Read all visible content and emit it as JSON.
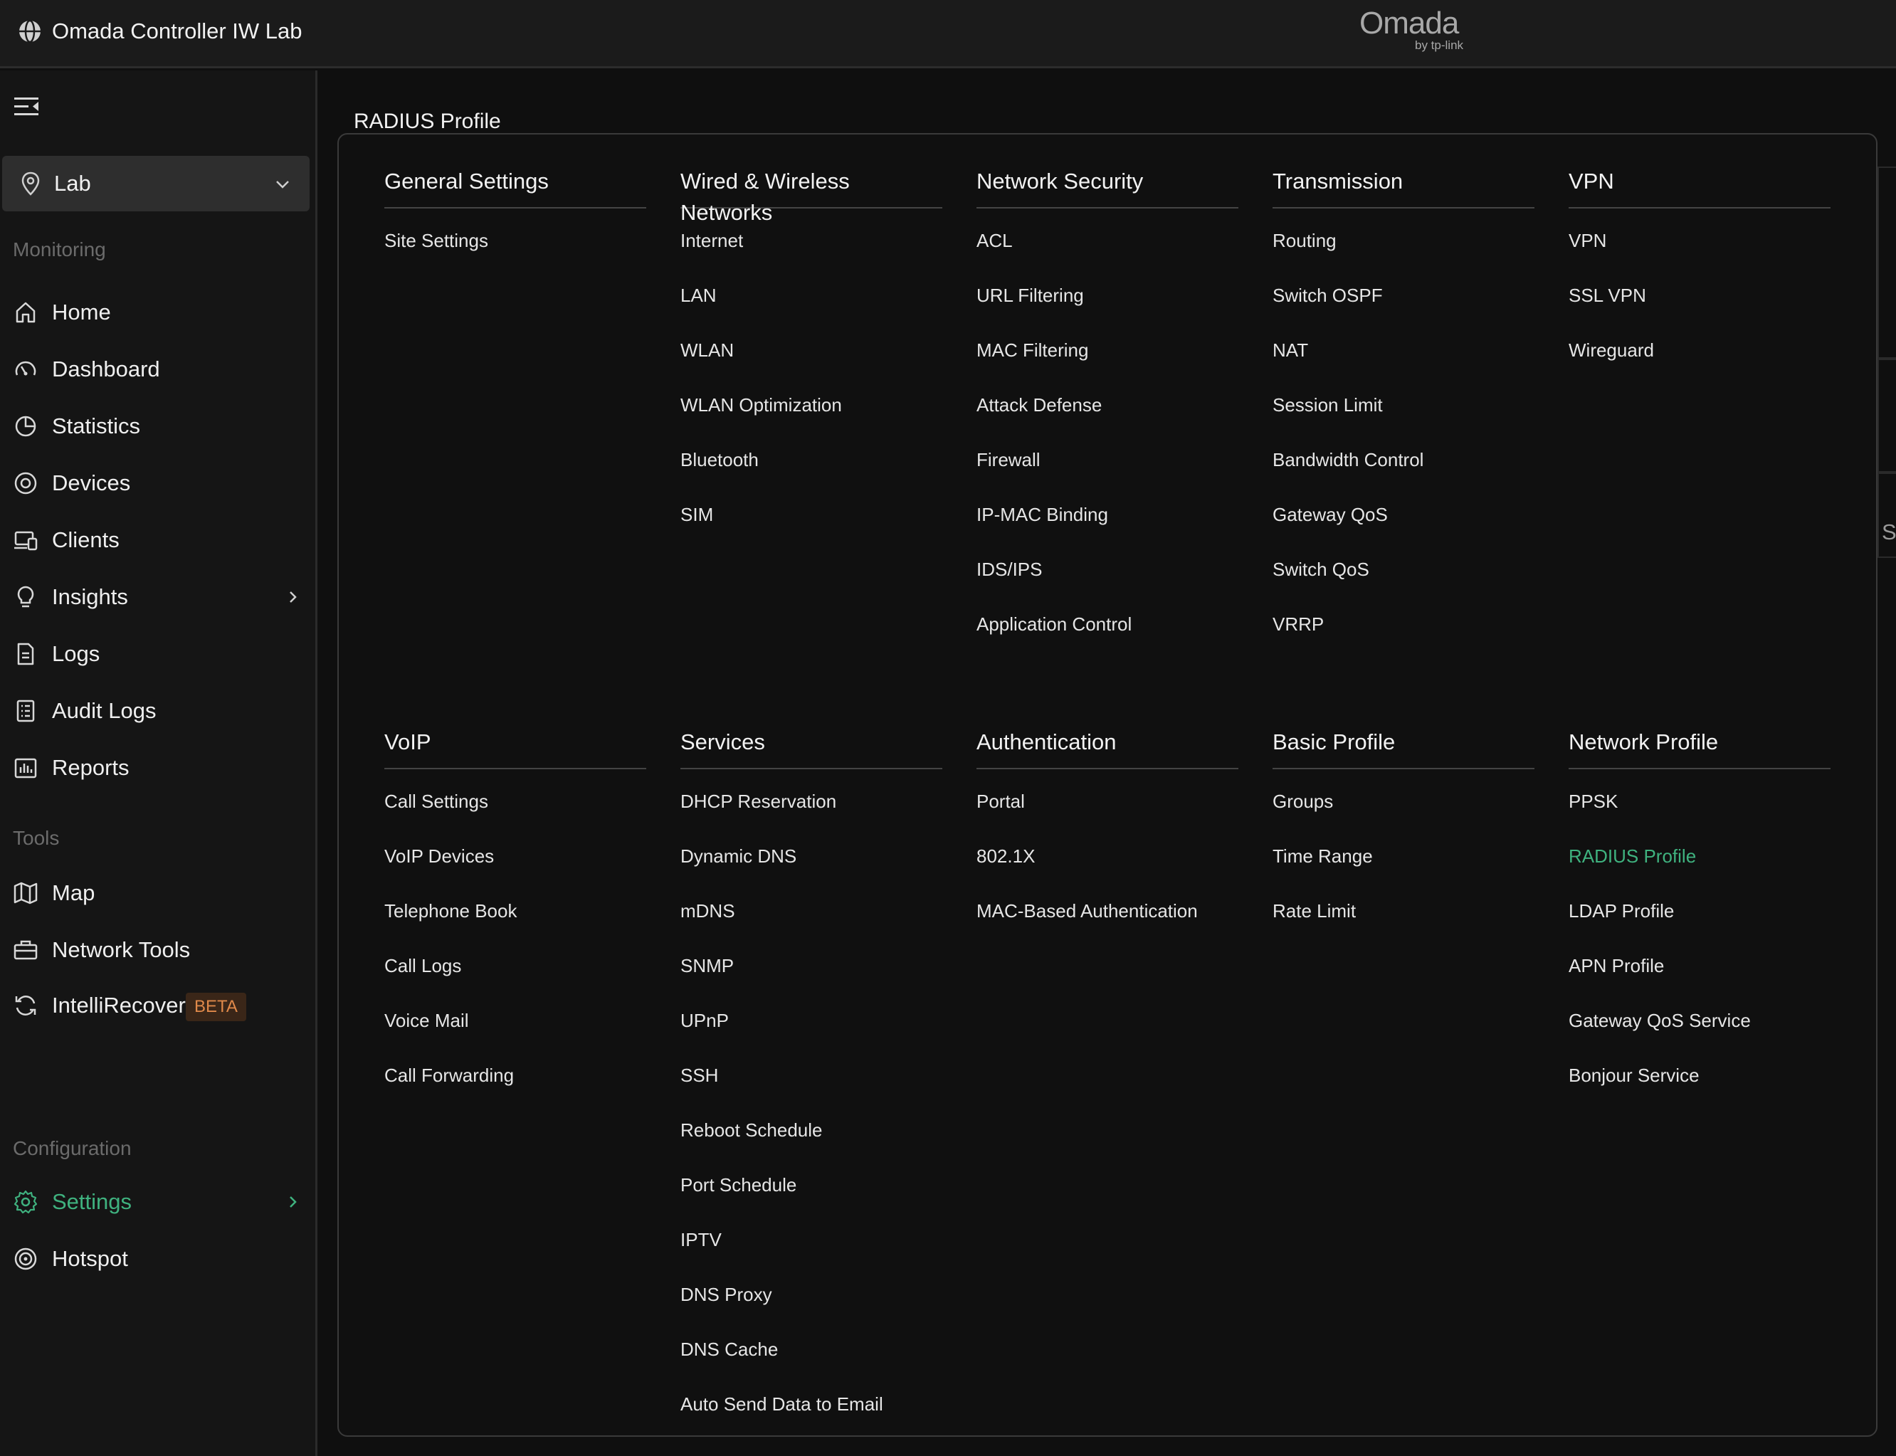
{
  "app": {
    "title": "Omada Controller IW Lab",
    "brand_name": "Omada",
    "brand_sub": "by tp-link"
  },
  "colors": {
    "accent": "#3fb27f",
    "background": "#0f0f0f",
    "beta_text": "#e0894a"
  },
  "sidebar": {
    "site_selector": {
      "value": "Lab"
    },
    "sections": [
      {
        "title": "Monitoring",
        "items": [
          {
            "label": "Home",
            "icon": "home-icon"
          },
          {
            "label": "Dashboard",
            "icon": "gauge-icon"
          },
          {
            "label": "Statistics",
            "icon": "pie-chart-icon"
          },
          {
            "label": "Devices",
            "icon": "devices-icon"
          },
          {
            "label": "Clients",
            "icon": "clients-icon"
          },
          {
            "label": "Insights",
            "icon": "lightbulb-icon",
            "has_arrow": true
          },
          {
            "label": "Logs",
            "icon": "document-icon"
          },
          {
            "label": "Audit Logs",
            "icon": "list-document-icon"
          },
          {
            "label": "Reports",
            "icon": "bar-chart-icon"
          }
        ]
      },
      {
        "title": "Tools",
        "items": [
          {
            "label": "Map",
            "icon": "map-icon"
          },
          {
            "label": "Network Tools",
            "icon": "toolbox-icon"
          },
          {
            "label": "IntelliRecover",
            "icon": "refresh-icon",
            "badge": "BETA"
          }
        ]
      },
      {
        "title": "Configuration",
        "items": [
          {
            "label": "Settings",
            "icon": "gear-icon",
            "has_arrow": true,
            "active": true
          },
          {
            "label": "Hotspot",
            "icon": "hotspot-icon"
          }
        ]
      }
    ]
  },
  "breadcrumb": "RADIUS Profile",
  "right_fragment": "S",
  "menu": {
    "columns": [
      {
        "title": "General Settings",
        "items": [
          "Site Settings"
        ]
      },
      {
        "title": "Wired & Wireless Networks",
        "items": [
          "Internet",
          "LAN",
          "WLAN",
          "WLAN Optimization",
          "Bluetooth",
          "SIM"
        ]
      },
      {
        "title": "Network Security",
        "items": [
          "ACL",
          "URL Filtering",
          "MAC Filtering",
          "Attack Defense",
          "Firewall",
          "IP-MAC Binding",
          "IDS/IPS",
          "Application Control"
        ]
      },
      {
        "title": "Transmission",
        "items": [
          "Routing",
          "Switch OSPF",
          "NAT",
          "Session Limit",
          "Bandwidth Control",
          "Gateway QoS",
          "Switch QoS",
          "VRRP"
        ]
      },
      {
        "title": "VPN",
        "items": [
          "VPN",
          "SSL VPN",
          "Wireguard"
        ]
      },
      {
        "title": "VoIP",
        "items": [
          "Call Settings",
          "VoIP Devices",
          "Telephone Book",
          "Call Logs",
          "Voice Mail",
          "Call Forwarding"
        ]
      },
      {
        "title": "Services",
        "items": [
          "DHCP Reservation",
          "Dynamic DNS",
          "mDNS",
          "SNMP",
          "UPnP",
          "SSH",
          "Reboot Schedule",
          "Port Schedule",
          "IPTV",
          "DNS Proxy",
          "DNS Cache",
          "Auto Send Data to Email"
        ]
      },
      {
        "title": "Authentication",
        "items": [
          "Portal",
          "802.1X",
          "MAC-Based Authentication"
        ]
      },
      {
        "title": "Basic Profile",
        "items": [
          "Groups",
          "Time Range",
          "Rate Limit"
        ]
      },
      {
        "title": "Network Profile",
        "items": [
          "PPSK",
          "RADIUS Profile",
          "LDAP Profile",
          "APN Profile",
          "Gateway QoS Service",
          "Bonjour Service"
        ],
        "active_item": "RADIUS Profile"
      }
    ]
  }
}
